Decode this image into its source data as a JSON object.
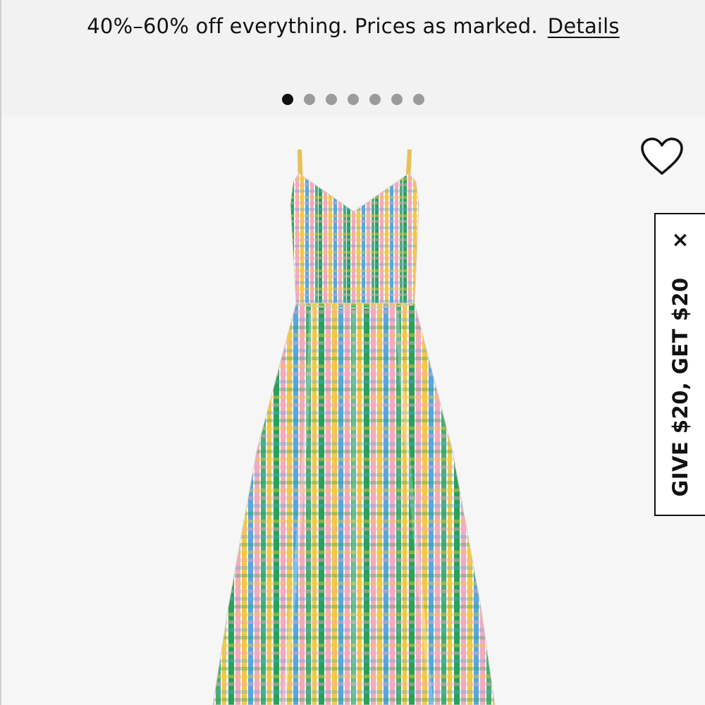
{
  "promo": {
    "message": "40%–60% off everything. Prices as marked.",
    "details_link": "Details",
    "carousel_slide_count": 7,
    "carousel_active_index": 0
  },
  "product": {
    "image_icon": "gingham-maxi-dress-photo",
    "wishlist_icon": "heart-outline-icon"
  },
  "referral": {
    "label": "GIVE $20, GET $20",
    "close_glyph": "×"
  },
  "colors": {
    "banner_bg": "#f2f2f2",
    "product_bg": "#f6f6f7",
    "dot_active": "#111111",
    "dot_inactive": "#9b9b9b"
  }
}
